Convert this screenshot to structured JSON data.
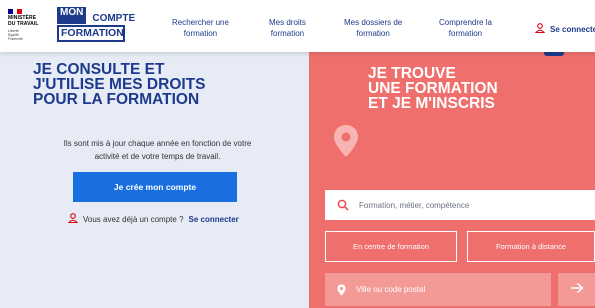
{
  "header": {
    "gov": {
      "lines": [
        "MINISTÈRE",
        "DU TRAVAIL"
      ],
      "motto": "Liberté Égalité Fraternité"
    },
    "logo": {
      "mon": "MON",
      "compte": "COMPTE",
      "formation": "FORMATION"
    },
    "nav": [
      {
        "line1": "Rechercher une",
        "line2": "formation"
      },
      {
        "line1": "Mes droits",
        "line2": "formation"
      },
      {
        "line1": "Mes dossiers de",
        "line2": "formation"
      },
      {
        "line1": "Comprendre la",
        "line2": "formation"
      }
    ],
    "login_label": "Se connecter"
  },
  "left_panel": {
    "title": [
      "JE CONSULTE ET",
      "J'UTILISE MES DROITS",
      "POUR LA FORMATION"
    ],
    "description": "Ils sont mis à jour chaque année en fonction de votre activité et de votre temps de travail.",
    "cta_label": "Je crée mon compte",
    "account_question": "Vous avez déjà un compte ?",
    "account_link": "Se connecter"
  },
  "right_panel": {
    "title": [
      "JE TROUVE",
      "UNE FORMATION",
      "ET JE M'INSCRIS"
    ],
    "search_placeholder": "Formation, métier, compétence",
    "mode_options": [
      "En centre de formation",
      "Formation à distance"
    ],
    "city_placeholder": "Ville ou code postal"
  },
  "colors": {
    "brand_blue": "#1e3a8c",
    "cta_blue": "#1a6fe0",
    "left_bg": "#e6ebf5",
    "right_bg": "#ef6f6c",
    "accent_red": "#e1000f"
  },
  "icons": [
    "user-icon",
    "location-pin-icon",
    "search-icon",
    "arrow-right-icon"
  ]
}
